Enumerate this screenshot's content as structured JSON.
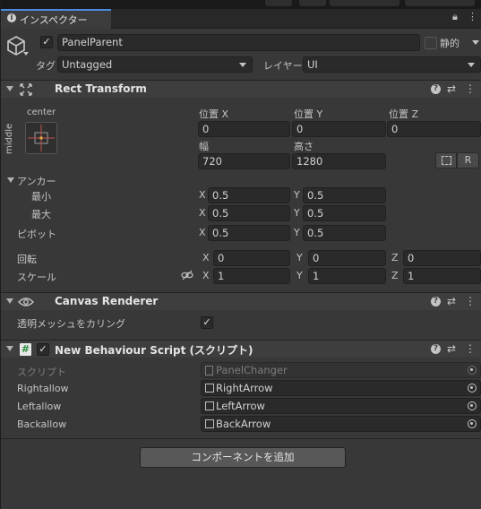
{
  "tab": {
    "title": "インスペクター"
  },
  "gameobject": {
    "name": "PanelParent",
    "active": true,
    "static_label": "静的",
    "tag_label": "タグ",
    "tag_value": "Untagged",
    "layer_label": "レイヤー",
    "layer_value": "UI"
  },
  "rect_transform": {
    "title": "Rect Transform",
    "anchor_preset_h": "center",
    "anchor_preset_v": "middle",
    "pos_x_label": "位置 X",
    "pos_y_label": "位置 Y",
    "pos_z_label": "位置 Z",
    "pos_x": "0",
    "pos_y": "0",
    "pos_z": "0",
    "width_label": "幅",
    "height_label": "高さ",
    "width": "720",
    "height": "1280",
    "raw_button": "R",
    "anchors_label": "アンカー",
    "min_label": "最小",
    "max_label": "最大",
    "pivot_label": "ピボット",
    "anchor_min_x": "0.5",
    "anchor_min_y": "0.5",
    "anchor_max_x": "0.5",
    "anchor_max_y": "0.5",
    "pivot_x": "0.5",
    "pivot_y": "0.5",
    "rotation_label": "回転",
    "rotation_x": "0",
    "rotation_y": "0",
    "rotation_z": "0",
    "scale_label": "スケール",
    "scale_x": "1",
    "scale_y": "1",
    "scale_z": "1",
    "axis_x": "X",
    "axis_y": "Y",
    "axis_z": "Z"
  },
  "canvas_renderer": {
    "title": "Canvas Renderer",
    "cull_label": "透明メッシュをカリング",
    "cull_checked": true
  },
  "script_component": {
    "title": "New Behaviour Script (スクリプト)",
    "script_label": "スクリプト",
    "script_value": "PanelChanger",
    "fields": [
      {
        "label": "Rightallow",
        "value": "RightArrow"
      },
      {
        "label": "Leftallow",
        "value": "LeftArrow"
      },
      {
        "label": "Backallow",
        "value": "BackArrow"
      }
    ]
  },
  "add_component_button": "コンポーネントを追加",
  "colors": {
    "accent": "#4c8ce0",
    "background": "#383838",
    "field": "#2a2a2a",
    "header": "#3e3e3e"
  }
}
